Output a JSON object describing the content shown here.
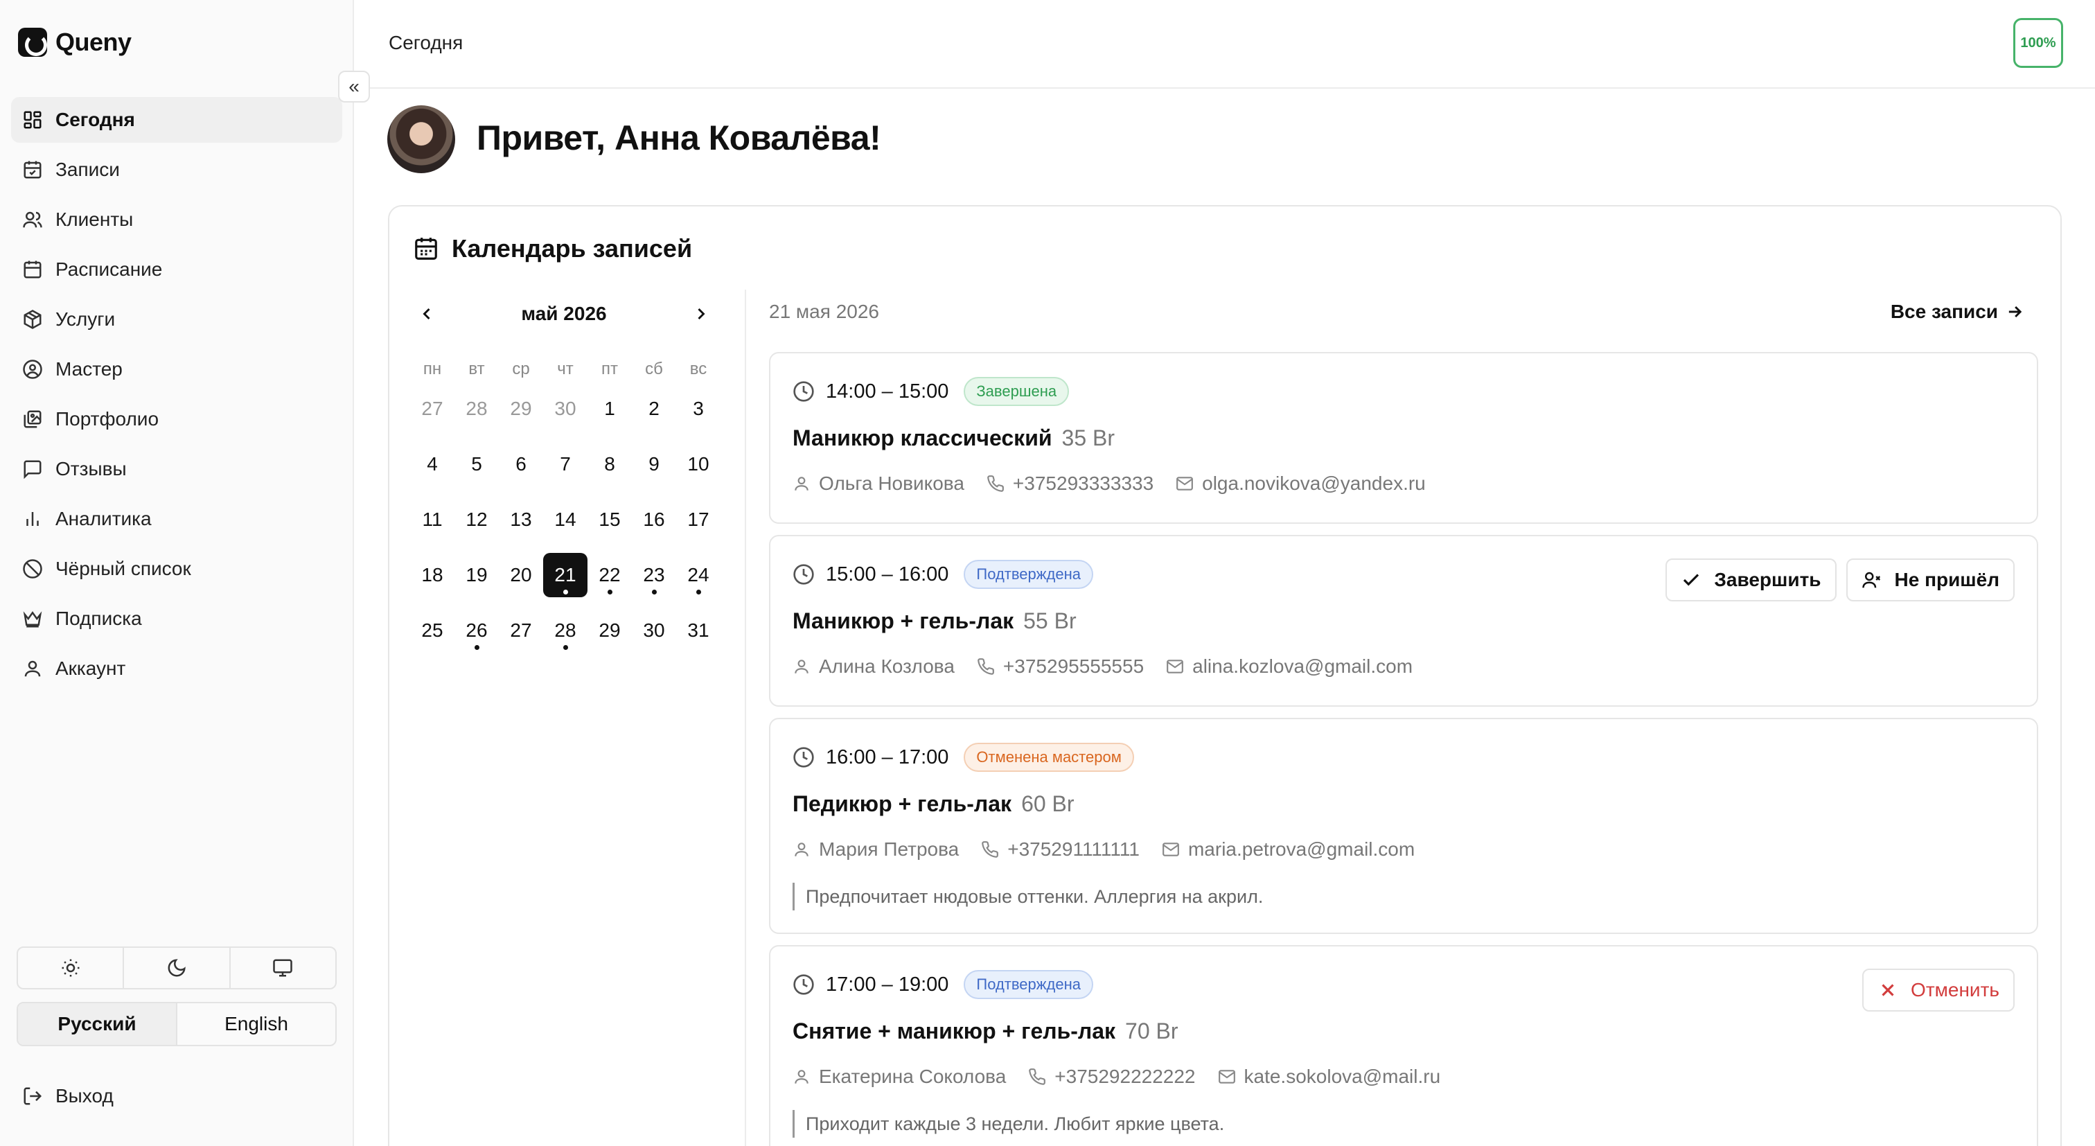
{
  "app": {
    "name": "Queny"
  },
  "sidebar": {
    "items": [
      {
        "label": "Сегодня",
        "icon": "dashboard-icon",
        "active": true
      },
      {
        "label": "Записи",
        "icon": "calendar-check-icon"
      },
      {
        "label": "Клиенты",
        "icon": "users-icon"
      },
      {
        "label": "Расписание",
        "icon": "calendar-icon"
      },
      {
        "label": "Услуги",
        "icon": "box-icon"
      },
      {
        "label": "Мастер",
        "icon": "user-circle-icon"
      },
      {
        "label": "Портфолио",
        "icon": "images-icon"
      },
      {
        "label": "Отзывы",
        "icon": "message-icon"
      },
      {
        "label": "Аналитика",
        "icon": "bar-chart-icon"
      },
      {
        "label": "Чёрный список",
        "icon": "ban-icon"
      },
      {
        "label": "Подписка",
        "icon": "crown-icon"
      },
      {
        "label": "Аккаунт",
        "icon": "user-icon"
      }
    ],
    "languages": {
      "ru": "Русский",
      "en": "English",
      "selected": "Русский"
    },
    "logout": "Выход"
  },
  "header": {
    "breadcrumb": "Сегодня",
    "progress": "100%"
  },
  "greeting": "Привет, Анна Ковалёва!",
  "calendar_card": {
    "title": "Календарь записей",
    "month_label": "май 2026",
    "weekdays": [
      "пн",
      "вт",
      "ср",
      "чт",
      "пт",
      "сб",
      "вс"
    ],
    "selected_day": "21",
    "days": [
      {
        "d": "27",
        "muted": true
      },
      {
        "d": "28",
        "muted": true
      },
      {
        "d": "29",
        "muted": true
      },
      {
        "d": "30",
        "muted": true
      },
      {
        "d": "1"
      },
      {
        "d": "2"
      },
      {
        "d": "3"
      },
      {
        "d": "4"
      },
      {
        "d": "5"
      },
      {
        "d": "6"
      },
      {
        "d": "7"
      },
      {
        "d": "8"
      },
      {
        "d": "9"
      },
      {
        "d": "10"
      },
      {
        "d": "11"
      },
      {
        "d": "12"
      },
      {
        "d": "13"
      },
      {
        "d": "14"
      },
      {
        "d": "15"
      },
      {
        "d": "16"
      },
      {
        "d": "17"
      },
      {
        "d": "18"
      },
      {
        "d": "19"
      },
      {
        "d": "20"
      },
      {
        "d": "21",
        "dot": true
      },
      {
        "d": "22",
        "dot": true
      },
      {
        "d": "23",
        "dot": true
      },
      {
        "d": "24",
        "dot": true
      },
      {
        "d": "25"
      },
      {
        "d": "26",
        "dot": true
      },
      {
        "d": "27"
      },
      {
        "d": "28",
        "dot": true
      },
      {
        "d": "29"
      },
      {
        "d": "30"
      },
      {
        "d": "31"
      }
    ],
    "list_date": "21 мая 2026",
    "all_link": "Все записи",
    "appointments": [
      {
        "time": "14:00 – 15:00",
        "status": "Завершена",
        "status_color": "#2e9d51",
        "service": "Маникюр классический",
        "price": "35 Br",
        "client": "Ольга Новикова",
        "phone": "+375293333333",
        "email": "olga.novikova@yandex.ru"
      },
      {
        "time": "15:00 – 16:00",
        "status": "Подтверждена",
        "status_color": "#3f69c6",
        "service": "Маникюр + гель-лак",
        "price": "55 Br",
        "client": "Алина Козлова",
        "phone": "+375295555555",
        "email": "alina.kozlova@gmail.com",
        "actions": {
          "complete": "Завершить",
          "no_show": "Не пришёл"
        }
      },
      {
        "time": "16:00 – 17:00",
        "status": "Отменена мастером",
        "status_color": "#d9661f",
        "service": "Педикюр + гель-лак",
        "price": "60 Br",
        "client": "Мария Петрова",
        "phone": "+375291111111",
        "email": "maria.petrova@gmail.com",
        "note": "Предпочитает нюдовые оттенки. Аллергия на акрил."
      },
      {
        "time": "17:00 – 19:00",
        "status": "Подтверждена",
        "status_color": "#3f69c6",
        "service": "Снятие + маникюр + гель-лак",
        "price": "70 Br",
        "client": "Екатерина Соколова",
        "phone": "+375292222222",
        "email": "kate.sokolova@mail.ru",
        "note": "Приходит каждые 3 недели. Любит яркие цвета.",
        "actions": {
          "cancel": "Отменить"
        }
      }
    ]
  }
}
